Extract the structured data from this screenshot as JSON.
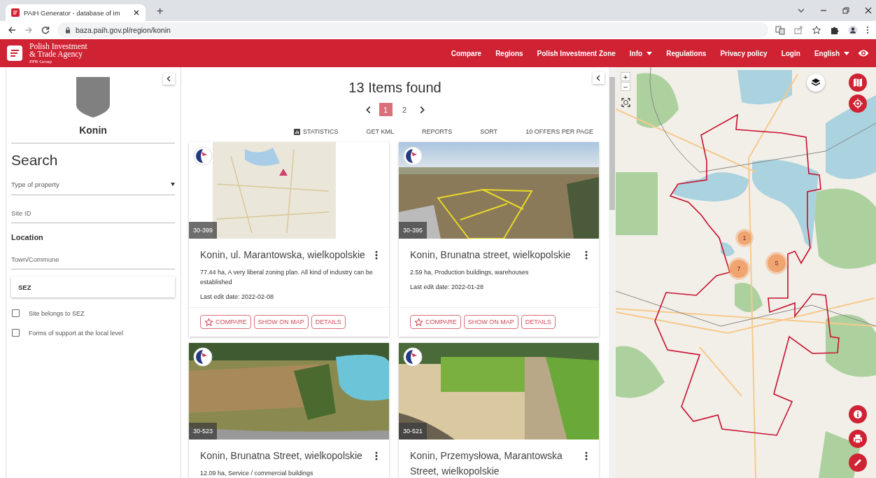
{
  "browser": {
    "tab_title": "PAIH Generator - database of im",
    "url": "baza.paih.gov.pl/region/konin",
    "new_tab": "+"
  },
  "header": {
    "brand": [
      "Polish Investment",
      "& Trade Agency"
    ],
    "group": "PFR Group",
    "nav": [
      {
        "label": "Compare",
        "dropdown": false
      },
      {
        "label": "Regions",
        "dropdown": false
      },
      {
        "label": "Polish Investment Zone",
        "dropdown": false
      },
      {
        "label": "Info",
        "dropdown": true
      },
      {
        "label": "Regulations",
        "dropdown": false
      },
      {
        "label": "Privacy policy",
        "dropdown": false
      },
      {
        "label": "Login",
        "dropdown": false
      },
      {
        "label": "English",
        "dropdown": true
      }
    ]
  },
  "sidebar": {
    "region": "Konin",
    "title": "Search",
    "fields": [
      {
        "kind": "select",
        "placeholder": "Type of property"
      },
      {
        "kind": "input",
        "placeholder": "Site ID"
      },
      {
        "kind": "heading",
        "label": "Location"
      },
      {
        "kind": "input",
        "placeholder": "Town/Commune"
      },
      {
        "kind": "box",
        "value": "SEZ"
      },
      {
        "kind": "checkbox",
        "label": "Site belongs to SEZ",
        "checked": false
      },
      {
        "kind": "checkbox",
        "label": "Forms of support at the local level",
        "checked": false
      }
    ]
  },
  "results": {
    "title": "13 Items found",
    "pages": [
      {
        "label": "1",
        "selected": true
      },
      {
        "label": "2",
        "selected": false
      }
    ],
    "toolbar": [
      {
        "label": "STATISTICS",
        "kind": "icon"
      },
      {
        "label": "GET KML",
        "kind": "plain"
      },
      {
        "label": "REPORTS",
        "kind": "plain"
      },
      {
        "label": "SORT",
        "kind": "plain"
      },
      {
        "label": "10 OFFERS PER PAGE",
        "kind": "plain"
      }
    ],
    "cards": [
      {
        "id": "30-399",
        "kind": "map",
        "title": "Konin, ul. Marantowska, wielkopolskie",
        "description": "77.44 ha, A very liberal zoning plan. All kind of industry can be established",
        "date": "Last edit date: 2022-02-08",
        "actions": [
          {
            "label": "COMPARE",
            "kind": "star"
          },
          {
            "label": "SHOW ON MAP",
            "kind": "plain"
          },
          {
            "label": "DETAILS",
            "kind": "plain"
          }
        ]
      },
      {
        "id": "30-395",
        "kind": "photo",
        "title": "Konin, Brunatna street, wielkopolskie",
        "description": "2.59 ha, Production buildings, warehouses",
        "date": "Last edit date: 2022-01-28",
        "actions": [
          {
            "label": "COMPARE",
            "kind": "star"
          },
          {
            "label": "SHOW ON MAP",
            "kind": "plain"
          },
          {
            "label": "DETAILS",
            "kind": "plain"
          }
        ]
      },
      {
        "id": "30-523",
        "kind": "photo",
        "title": "Konin, Brunatna Street, wielkopolskie",
        "description": "12.09 ha, Service / commercial buildings"
      },
      {
        "id": "30-521",
        "kind": "photo",
        "title": "Konin, Przemysłowa, Marantowska Street, wielkopolskie"
      }
    ]
  },
  "map": {
    "zoom_in": "+",
    "zoom_out": "−",
    "clusters": [
      {
        "count": "1"
      },
      {
        "count": "7"
      },
      {
        "count": "5"
      }
    ]
  }
}
